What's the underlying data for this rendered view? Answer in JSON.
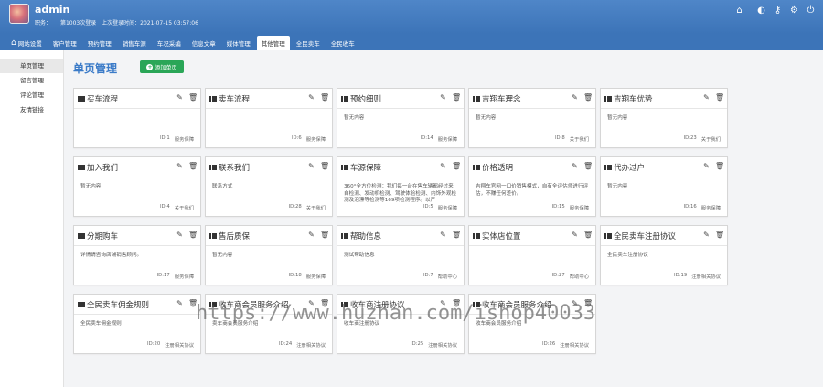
{
  "header": {
    "username": "admin",
    "role_label": "职务：",
    "login_count_text": "第1003次登录",
    "last_login_label": "上次登录时间：",
    "last_login_time": "2021-07-15 03:57:06",
    "icons": [
      "home-icon",
      "palette-icon",
      "key-icon",
      "gear-icon",
      "power-icon"
    ]
  },
  "nav": {
    "items": [
      "网站设置",
      "客户管理",
      "预约管理",
      "销售车源",
      "车况采编",
      "信息文章",
      "媒体管理",
      "其他管理",
      "全民卖车",
      "全民收车"
    ],
    "active_index": 7
  },
  "sidebar": {
    "items": [
      "单页管理",
      "留言管理",
      "评论管理",
      "友情链接"
    ],
    "active_index": 0
  },
  "main": {
    "title": "单页管理",
    "add_button": "添加单页"
  },
  "cards": [
    {
      "title": "买车流程",
      "body": "",
      "id_text": "ID:1",
      "category": "服务保障"
    },
    {
      "title": "卖车流程",
      "body": "",
      "id_text": "ID:6",
      "category": "服务保障"
    },
    {
      "title": "预约细则",
      "body": "暂无内容",
      "id_text": "ID:14",
      "category": "服务保障"
    },
    {
      "title": "吉翔车理念",
      "body": "暂无内容",
      "id_text": "ID:8",
      "category": "关于我们"
    },
    {
      "title": "吉翔车优势",
      "body": "暂无内容",
      "id_text": "ID:23",
      "category": "关于我们"
    },
    {
      "title": "加入我们",
      "body": "暂无内容",
      "id_text": "ID:4",
      "category": "关于我们"
    },
    {
      "title": "联系我们",
      "body": "联系方式",
      "id_text": "ID:28",
      "category": "关于我们"
    },
    {
      "title": "车源保障",
      "body": "360°全方位检测：我们每一台在售车辆都经过来自检测、发动机检测、驾驶体验检测、内饰外观检测及泡漂等检测等169项检测程序。以严",
      "id_text": "ID:5",
      "category": "服务保障"
    },
    {
      "title": "价格透明",
      "body": "吉翔车官网一口价销售模式，自有全评估师进行评估，不赚任何差价。",
      "id_text": "ID:15",
      "category": "服务保障"
    },
    {
      "title": "代办过户",
      "body": "暂无内容",
      "id_text": "ID:16",
      "category": "服务保障"
    },
    {
      "title": "分期购车",
      "body": "详情请咨询店铺销售顾问。",
      "id_text": "ID:17",
      "category": "服务保障"
    },
    {
      "title": "售后质保",
      "body": "暂无内容",
      "id_text": "ID:18",
      "category": "服务保障"
    },
    {
      "title": "帮助信息",
      "body": "测试帮助信息",
      "id_text": "ID:7",
      "category": "帮助中心"
    },
    {
      "title": "实体店位置",
      "body": "",
      "id_text": "ID:27",
      "category": "帮助中心"
    },
    {
      "title": "全民卖车注册协议",
      "body": "全民卖车注册协议",
      "id_text": "ID:19",
      "category": "注册相关协议"
    },
    {
      "title": "全民卖车佣金规则",
      "body": "全民卖车佣金规则",
      "id_text": "ID:20",
      "category": "注册相关协议"
    },
    {
      "title": "收车商会员服务介绍",
      "body": "卖车商会员服务介绍",
      "id_text": "ID:24",
      "category": "注册相关协议"
    },
    {
      "title": "收车商注册协议",
      "body": "收车商注册协议",
      "id_text": "ID:25",
      "category": "注册相关协议"
    },
    {
      "title": "收车商会员服务介绍",
      "body": "收车商会员服务介绍",
      "id_text": "ID:26",
      "category": "注册相关协议"
    }
  ],
  "watermark": "https://www.huzhan.com/ishop40033"
}
